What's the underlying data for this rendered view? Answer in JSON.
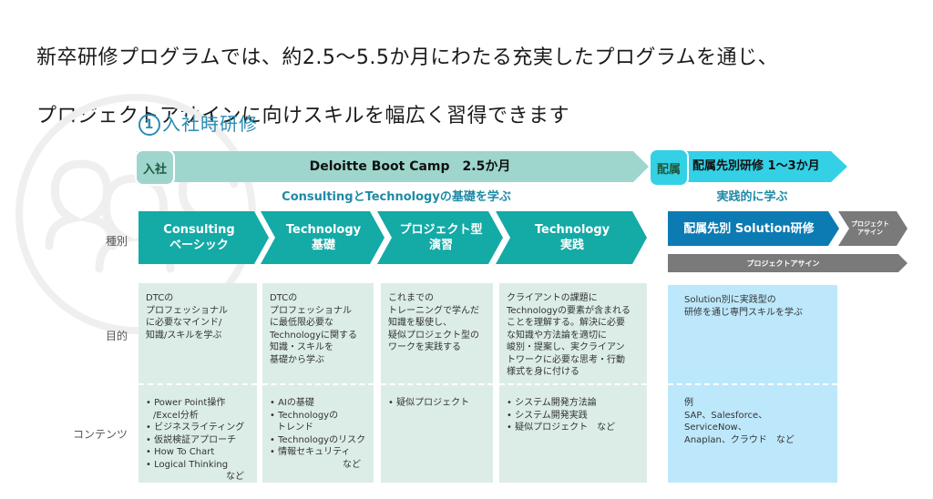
{
  "headline": {
    "line1": "新卒研修プログラムでは、約2.5〜5.5か月にわたる充実したプログラムを通じ、",
    "line2": "プロジェクトアサインに向けスキルを幅広く習得できます"
  },
  "section_title": {
    "number": "1",
    "label": "入社時研修"
  },
  "timeline": {
    "start_badge": "入社",
    "bootcamp_label": "Deloitte Boot Camp　2.5か月",
    "assign_badge": "配属",
    "assign_label": "配属先別研修 1〜3か月",
    "subhead_left": "ConsultingとTechnologyの基礎を学ぶ",
    "subhead_right": "実践的に学ぶ"
  },
  "row_labels": {
    "type": "種別",
    "purpose": "目的",
    "content": "コンテンツ"
  },
  "colors": {
    "teal": "#14aaa6",
    "light_teal": "#9ed6cd",
    "cyan": "#34d0e6",
    "blue": "#0c7bb3",
    "gray": "#7a7a7a",
    "cell_green": "#dcede8",
    "cell_blue": "#bde8fb",
    "title_blue": "#2b8cb3"
  },
  "columns": [
    {
      "title1": "Consulting",
      "title2": "ベーシック",
      "purpose": [
        "DTCの",
        "プロフェッショナル",
        "に必要なマインド/",
        "知識/スキルを学ぶ"
      ],
      "contents": [
        "Power Point操作",
        "/Excel分析",
        "ビジネスライティング",
        "仮説検証アプローチ",
        "How To Chart",
        "Logical Thinking"
      ],
      "contents_suffix": "など"
    },
    {
      "title1": "Technology",
      "title2": "基礎",
      "purpose": [
        "DTCの",
        "プロフェッショナル",
        "に最低限必要な",
        "Technologyに関する",
        "知識・スキルを",
        "基礎から学ぶ"
      ],
      "contents": [
        "AIの基礎",
        "Technologyの",
        "トレンド",
        "Technologyのリスク",
        "情報セキュリティ"
      ],
      "contents_suffix": "など"
    },
    {
      "title1": "プロジェクト型",
      "title2": "演習",
      "purpose": [
        "これまでの",
        "トレーニングで学んだ",
        "知識を駆使し、",
        "疑似プロジェクト型の",
        "ワークを実践する"
      ],
      "contents": [
        "疑似プロジェクト"
      ],
      "contents_suffix": ""
    },
    {
      "title1": "Technology",
      "title2": "実践",
      "purpose": [
        "クライアントの課題に",
        "Technologyの要素が含まれる",
        "ことを理解する。解決に必要",
        "な知識や方法論を適切に",
        "峻別・提案し、実クライアン",
        "トワークに必要な思考・行動",
        "様式を身に付ける"
      ],
      "contents": [
        "システム開発方法論",
        "システム開発実践",
        "疑似プロジェクト　など"
      ],
      "contents_suffix": ""
    }
  ],
  "solution": {
    "title": "配属先別 Solution研修",
    "next_step": [
      "プロジェクト",
      "アサイン"
    ],
    "assign_bar": "プロジェクトアサイン",
    "purpose": [
      "Solution別に実践型の",
      "研修を通じ専門スキルを学ぶ"
    ],
    "contents": [
      "例",
      "SAP、Salesforce、",
      "ServiceNow、",
      "Anaplan、クラウド　など"
    ]
  }
}
